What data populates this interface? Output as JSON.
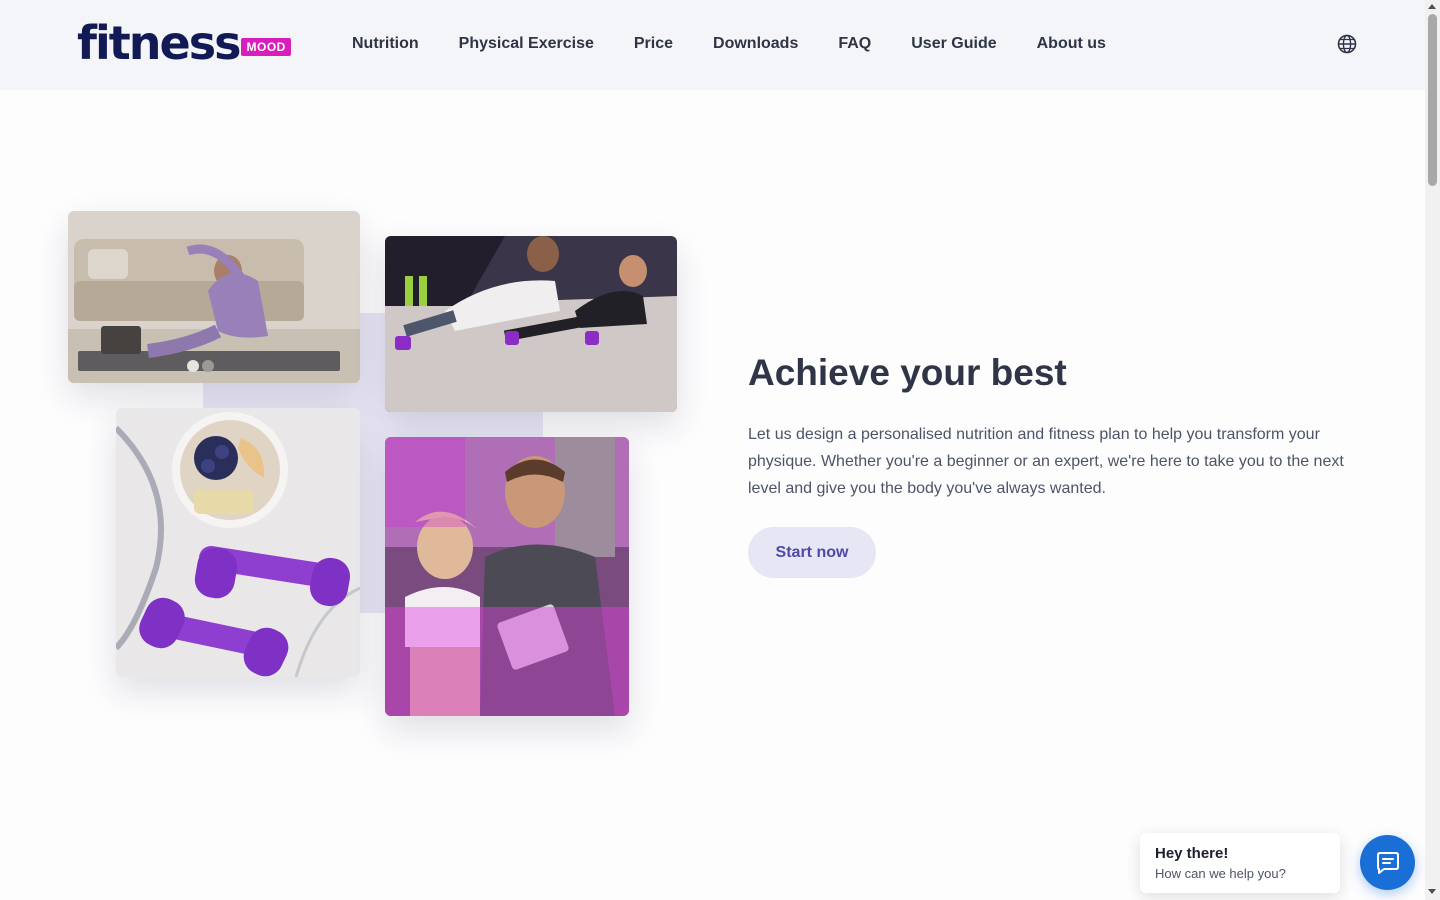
{
  "brand": {
    "name": "fitness",
    "badge": "MOOD"
  },
  "nav": [
    {
      "label": "Nutrition"
    },
    {
      "label": "Physical Exercise"
    },
    {
      "label": "Price"
    },
    {
      "label": "Downloads"
    },
    {
      "label": "FAQ"
    },
    {
      "label": "User Guide"
    },
    {
      "label": "About us"
    }
  ],
  "header": {
    "language_icon": "globe-icon"
  },
  "hero": {
    "title": "Achieve your best",
    "description": "Let us design a personalised nutrition and fitness plan to help you transform your physique. Whether you're a beginner or an expert, we're here to take you to the next level and give you the body you've always wanted.",
    "cta_label": "Start now",
    "images": [
      "woman-stretching-photo",
      "couple-plank-photo",
      "fruit-bowl-dumbbells-photo",
      "trainer-client-photo"
    ]
  },
  "chat": {
    "title": "Hey there!",
    "subtitle": "How can we help you?",
    "icon": "chat-icon"
  },
  "colors": {
    "brand_navy": "#111a55",
    "brand_magenta": "#d81fbd",
    "cta_bg": "#e7e6f4",
    "cta_text": "#4e4aa6",
    "chat_blue": "#1a6fd6"
  }
}
